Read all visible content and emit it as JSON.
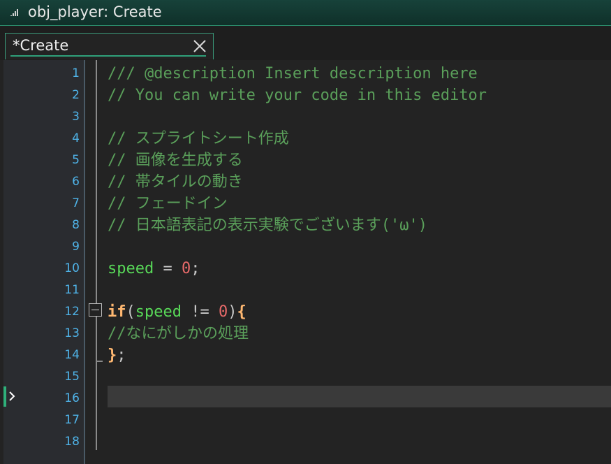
{
  "window": {
    "title": "obj_player: Create"
  },
  "tabs": [
    {
      "label": "*Create",
      "active": true
    }
  ],
  "editor": {
    "current_line": 16,
    "lines": [
      {
        "num": "1",
        "tokens": [
          {
            "t": "/// @description Insert description here",
            "c": "comment"
          }
        ]
      },
      {
        "num": "2",
        "tokens": [
          {
            "t": "// You can write your code in this editor",
            "c": "comment"
          }
        ]
      },
      {
        "num": "3",
        "tokens": []
      },
      {
        "num": "4",
        "tokens": [
          {
            "t": "// スプライトシート作成",
            "c": "comment"
          }
        ]
      },
      {
        "num": "5",
        "tokens": [
          {
            "t": "// 画像を生成する",
            "c": "comment"
          }
        ]
      },
      {
        "num": "6",
        "tokens": [
          {
            "t": "// 帯タイルの動き",
            "c": "comment"
          }
        ]
      },
      {
        "num": "7",
        "tokens": [
          {
            "t": "// フェードイン",
            "c": "comment"
          }
        ]
      },
      {
        "num": "8",
        "tokens": [
          {
            "t": "// 日本語表記の表示実験でございます('ω')",
            "c": "comment"
          }
        ]
      },
      {
        "num": "9",
        "tokens": []
      },
      {
        "num": "10",
        "tokens": [
          {
            "t": "speed",
            "c": "var"
          },
          {
            "t": " = ",
            "c": "op"
          },
          {
            "t": "0",
            "c": "num"
          },
          {
            "t": ";",
            "c": "op"
          }
        ]
      },
      {
        "num": "11",
        "tokens": []
      },
      {
        "num": "12",
        "tokens": [
          {
            "t": "if",
            "c": "kw"
          },
          {
            "t": "(",
            "c": "op"
          },
          {
            "t": "speed",
            "c": "var"
          },
          {
            "t": " != ",
            "c": "op"
          },
          {
            "t": "0",
            "c": "num"
          },
          {
            "t": ")",
            "c": "op"
          },
          {
            "t": "{",
            "c": "brace"
          }
        ]
      },
      {
        "num": "13",
        "tokens": [
          {
            "t": "//なにがしかの処理",
            "c": "comment"
          }
        ]
      },
      {
        "num": "14",
        "tokens": [
          {
            "t": "}",
            "c": "brace"
          },
          {
            "t": ";",
            "c": "op"
          }
        ]
      },
      {
        "num": "15",
        "tokens": []
      },
      {
        "num": "16",
        "tokens": []
      },
      {
        "num": "17",
        "tokens": []
      },
      {
        "num": "18",
        "tokens": []
      }
    ]
  },
  "colors": {
    "comment": "#5a9f5a",
    "variable": "#58d858",
    "number": "#e86a6a",
    "keyword": "#ffb871",
    "line_number": "#4fb3e8",
    "accent": "#2fa07a"
  },
  "icons": {
    "title": "resize-grip-icon",
    "tab_close": "close-icon",
    "fold": "fold-collapse-icon",
    "caret": "current-line-arrow-icon"
  }
}
